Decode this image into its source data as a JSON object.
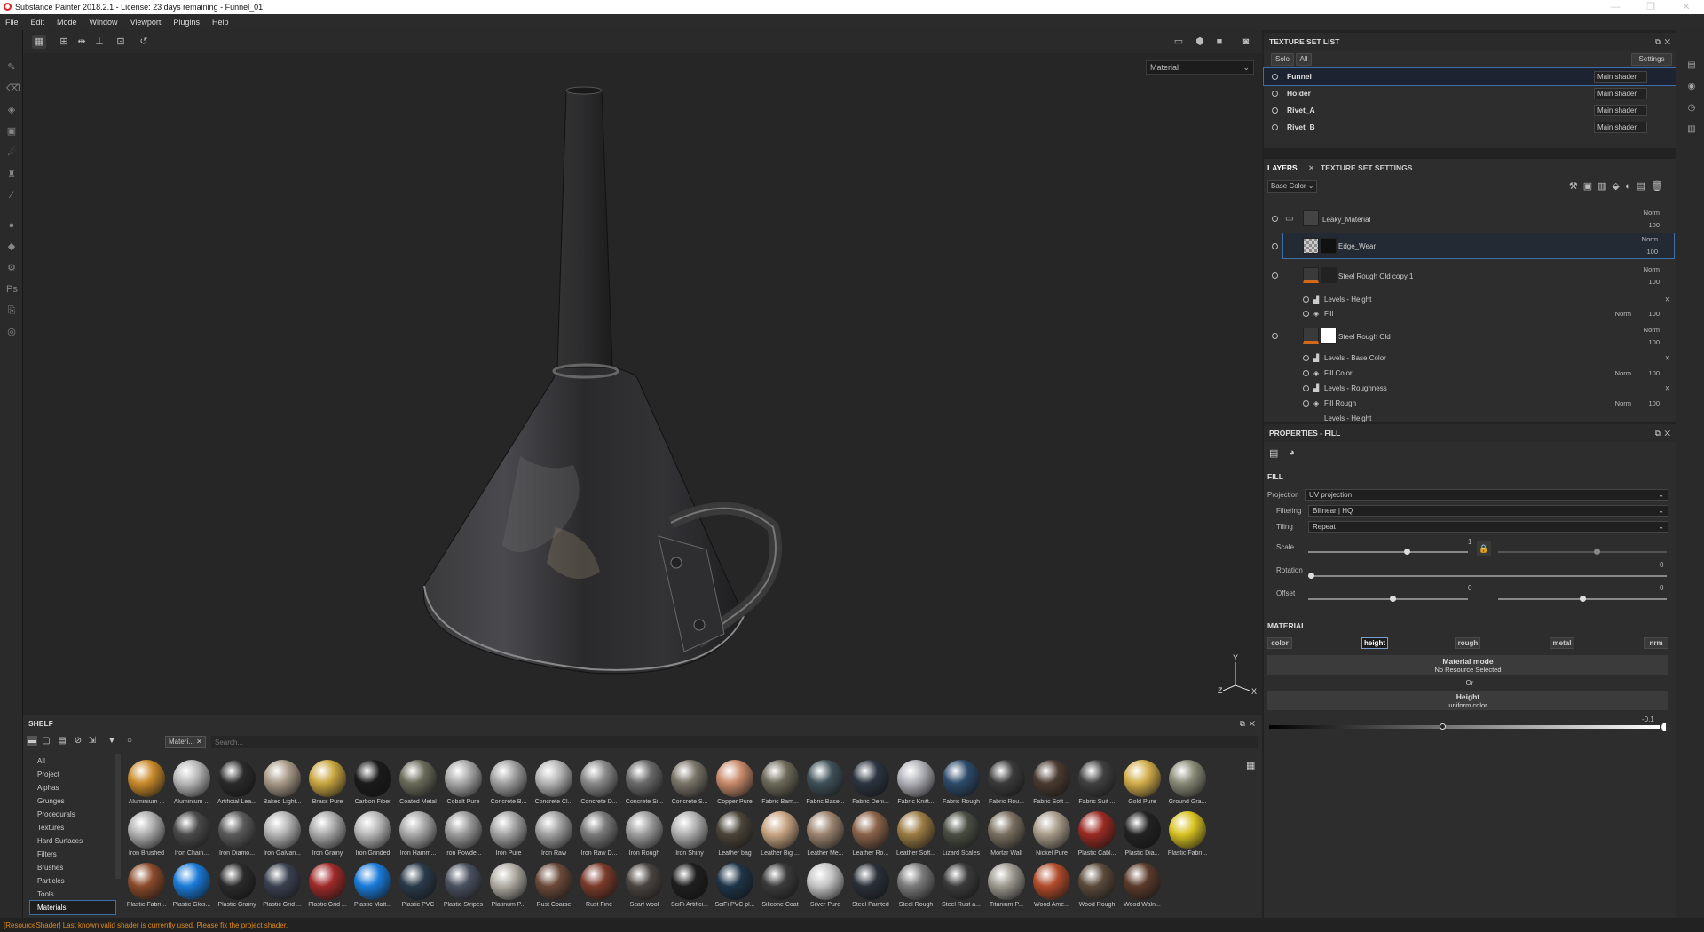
{
  "window": {
    "title": "Substance Painter 2018.2.1 - License: 23 days remaining - Funnel_01",
    "controls": [
      "—",
      "❐",
      "✕"
    ]
  },
  "menu": [
    "File",
    "Edit",
    "Mode",
    "Window",
    "Viewport",
    "Plugins",
    "Help"
  ],
  "viewport": {
    "material_mode": "Material",
    "axis": {
      "y": "Y",
      "z": "Z",
      "x": "X"
    }
  },
  "texture_set_list": {
    "title": "TEXTURE SET LIST",
    "solo": "Solo",
    "all": "All",
    "settings": "Settings",
    "rows": [
      {
        "name": "Funnel",
        "shader": "Main shader"
      },
      {
        "name": "Holder",
        "shader": "Main shader"
      },
      {
        "name": "Rivet_A",
        "shader": "Main shader"
      },
      {
        "name": "Rivet_B",
        "shader": "Main shader"
      }
    ]
  },
  "layers": {
    "tab_layers": "LAYERS",
    "tab_tss": "TEXTURE SET SETTINGS",
    "channel": "Base Color",
    "rows": [
      {
        "name": "Leaky_Material",
        "blend": "Norm",
        "opacity": "100"
      },
      {
        "name": "Edge_Wear",
        "blend": "Norm",
        "opacity": "100"
      },
      {
        "name": "Steel Rough Old copy 1",
        "blend": "Norm",
        "opacity": "100"
      },
      {
        "name": "Levels - Height"
      },
      {
        "name": "Fill",
        "blend": "Norm",
        "opacity": "100"
      },
      {
        "name": "Steel Rough Old",
        "blend": "Norm",
        "opacity": "100"
      },
      {
        "name": "Levels - Base Color"
      },
      {
        "name": "Fill Color",
        "blend": "Norm",
        "opacity": "100"
      },
      {
        "name": "Levels - Roughness"
      },
      {
        "name": "Fill Rough",
        "blend": "Norm",
        "opacity": "100"
      },
      {
        "name": "Levels - Height"
      }
    ]
  },
  "properties": {
    "title": "PROPERTIES - FILL",
    "fill": "FILL",
    "projection_label": "Projection",
    "projection": "UV projection",
    "filtering_label": "Filtering",
    "filtering": "Bilinear | HQ",
    "tiling_label": "Tiling",
    "tiling": "Repeat",
    "scale_label": "Scale",
    "scale": "1",
    "rotation_label": "Rotation",
    "rotation": "0",
    "offset_label": "Offset",
    "offset_u": "0",
    "offset_v": "0",
    "material": "MATERIAL",
    "chips": [
      "color",
      "height",
      "rough",
      "metal",
      "nrm"
    ],
    "material_mode": "Material mode",
    "no_resource": "No Resource Selected",
    "or": "Or",
    "height": "Height",
    "uniform": "uniform color",
    "height_value": "-0.1"
  },
  "shelf": {
    "title": "SHELF",
    "filter": "Materi...",
    "search_placeholder": "Search...",
    "categories": [
      "All",
      "Project",
      "Alphas",
      "Grunges",
      "Procedurals",
      "Textures",
      "Hard Surfaces",
      "Filters",
      "Brushes",
      "Particles",
      "Tools",
      "Materials"
    ],
    "materials": [
      {
        "name": "Aluminium ...",
        "color": "#c98a2a"
      },
      {
        "name": "Aluminium ...",
        "color": "#b8b8b8"
      },
      {
        "name": "Artificial Lea...",
        "color": "#2a2a2a"
      },
      {
        "name": "Baked Light...",
        "color": "#a89a88"
      },
      {
        "name": "Brass Pure",
        "color": "#c9a640"
      },
      {
        "name": "Carbon Fiber",
        "color": "#1a1a1a"
      },
      {
        "name": "Coated Metal",
        "color": "#6a6a5a"
      },
      {
        "name": "Cobalt Pure",
        "color": "#a8a8a8"
      },
      {
        "name": "Concrete B...",
        "color": "#a0a0a0"
      },
      {
        "name": "Concrete Cl...",
        "color": "#b5b5b5"
      },
      {
        "name": "Concrete D...",
        "color": "#8a8a8a"
      },
      {
        "name": "Concrete Si...",
        "color": "#6a6a6a"
      },
      {
        "name": "Concrete S...",
        "color": "#7a7468"
      },
      {
        "name": "Copper Pure",
        "color": "#c88a6a"
      },
      {
        "name": "Fabric Bam...",
        "color": "#6e6a5a"
      },
      {
        "name": "Fabric Base...",
        "color": "#3e5058"
      },
      {
        "name": "Fabric Deni...",
        "color": "#2c3440"
      },
      {
        "name": "Fabric Knitt...",
        "color": "#b0b0b8"
      },
      {
        "name": "Fabric Rough",
        "color": "#2c4a6a"
      },
      {
        "name": "Fabric Rou...",
        "color": "#3a3a3a"
      },
      {
        "name": "Fabric Soft ...",
        "color": "#4a3a30"
      },
      {
        "name": "Fabric Suit ...",
        "color": "#404040"
      },
      {
        "name": "Gold Pure",
        "color": "#d2ad4a"
      },
      {
        "name": "Ground Gra...",
        "color": "#8a8a78"
      },
      {
        "name": "Iron Brushed",
        "color": "#b0b0b0"
      },
      {
        "name": "Iron Chain...",
        "color": "#4a4a4a"
      },
      {
        "name": "Iron Diamo...",
        "color": "#5a5a5a"
      },
      {
        "name": "Iron Galvan...",
        "color": "#b4b4b4"
      },
      {
        "name": "Iron Grainy",
        "color": "#aaaaaa"
      },
      {
        "name": "Iron Grinded",
        "color": "#b8b8b8"
      },
      {
        "name": "Iron Hamm...",
        "color": "#a8a8a8"
      },
      {
        "name": "Iron Powde...",
        "color": "#9a9a9a"
      },
      {
        "name": "Iron Pure",
        "color": "#a4a4a4"
      },
      {
        "name": "Iron Raw",
        "color": "#a0a0a0"
      },
      {
        "name": "Iron Raw D...",
        "color": "#7a7a7a"
      },
      {
        "name": "Iron Rough",
        "color": "#9c9c9c"
      },
      {
        "name": "Iron Shiny",
        "color": "#b0b0b0"
      },
      {
        "name": "Leather bag",
        "color": "#4a4438"
      },
      {
        "name": "Leather Big ...",
        "color": "#c8a482"
      },
      {
        "name": "Leather Me...",
        "color": "#9c8470"
      },
      {
        "name": "Leather Ro...",
        "color": "#8a6248"
      },
      {
        "name": "Leather Soft...",
        "color": "#9c7c44"
      },
      {
        "name": "Lizard Scales",
        "color": "#4a4e42"
      },
      {
        "name": "Mortar Wall",
        "color": "#7a7060"
      },
      {
        "name": "Nickel Pure",
        "color": "#a89c8a"
      },
      {
        "name": "Plastic Cabl...",
        "color": "#9a2a22"
      },
      {
        "name": "Plastic Dia...",
        "color": "#222222"
      },
      {
        "name": "Plastic Fabri...",
        "color": "#d8c222"
      },
      {
        "name": "Plastic Fabri...",
        "color": "#8a4a2a"
      },
      {
        "name": "Plastic Glos...",
        "color": "#1a7ad8"
      },
      {
        "name": "Plastic Grainy",
        "color": "#2a2a2a"
      },
      {
        "name": "Plastic Grid ...",
        "color": "#3a4050"
      },
      {
        "name": "Plastic Grid ...",
        "color": "#a02a2a"
      },
      {
        "name": "Plastic Matt...",
        "color": "#1a7ad8"
      },
      {
        "name": "Plastic PVC",
        "color": "#2a3a4a"
      },
      {
        "name": "Plastic Stripes",
        "color": "#4a5060"
      },
      {
        "name": "Platinum P...",
        "color": "#b0aca4"
      },
      {
        "name": "Rust Coarse",
        "color": "#6a4838"
      },
      {
        "name": "Rust Fine",
        "color": "#7a3a2a"
      },
      {
        "name": "Scarf wool",
        "color": "#4a4440"
      },
      {
        "name": "SciFi Artifici...",
        "color": "#1e1e1e"
      },
      {
        "name": "SciFi PVC pl...",
        "color": "#1e3448"
      },
      {
        "name": "Silicone Coat",
        "color": "#3a3a3a"
      },
      {
        "name": "Silver Pure",
        "color": "#c4c4c4"
      },
      {
        "name": "Steel Painted",
        "color": "#2a3038"
      },
      {
        "name": "Steel Rough",
        "color": "#7a7a7a"
      },
      {
        "name": "Steel Rust a...",
        "color": "#3a3a3a"
      },
      {
        "name": "Titanium P...",
        "color": "#9c9890"
      },
      {
        "name": "Wood Ame...",
        "color": "#b04a2a"
      },
      {
        "name": "Wood Rough",
        "color": "#5a4a3a"
      },
      {
        "name": "Wood Waln...",
        "color": "#5a3a2a"
      }
    ]
  },
  "status": "[ResourceShader] Last known valid shader is currently used. Please fix the project shader."
}
